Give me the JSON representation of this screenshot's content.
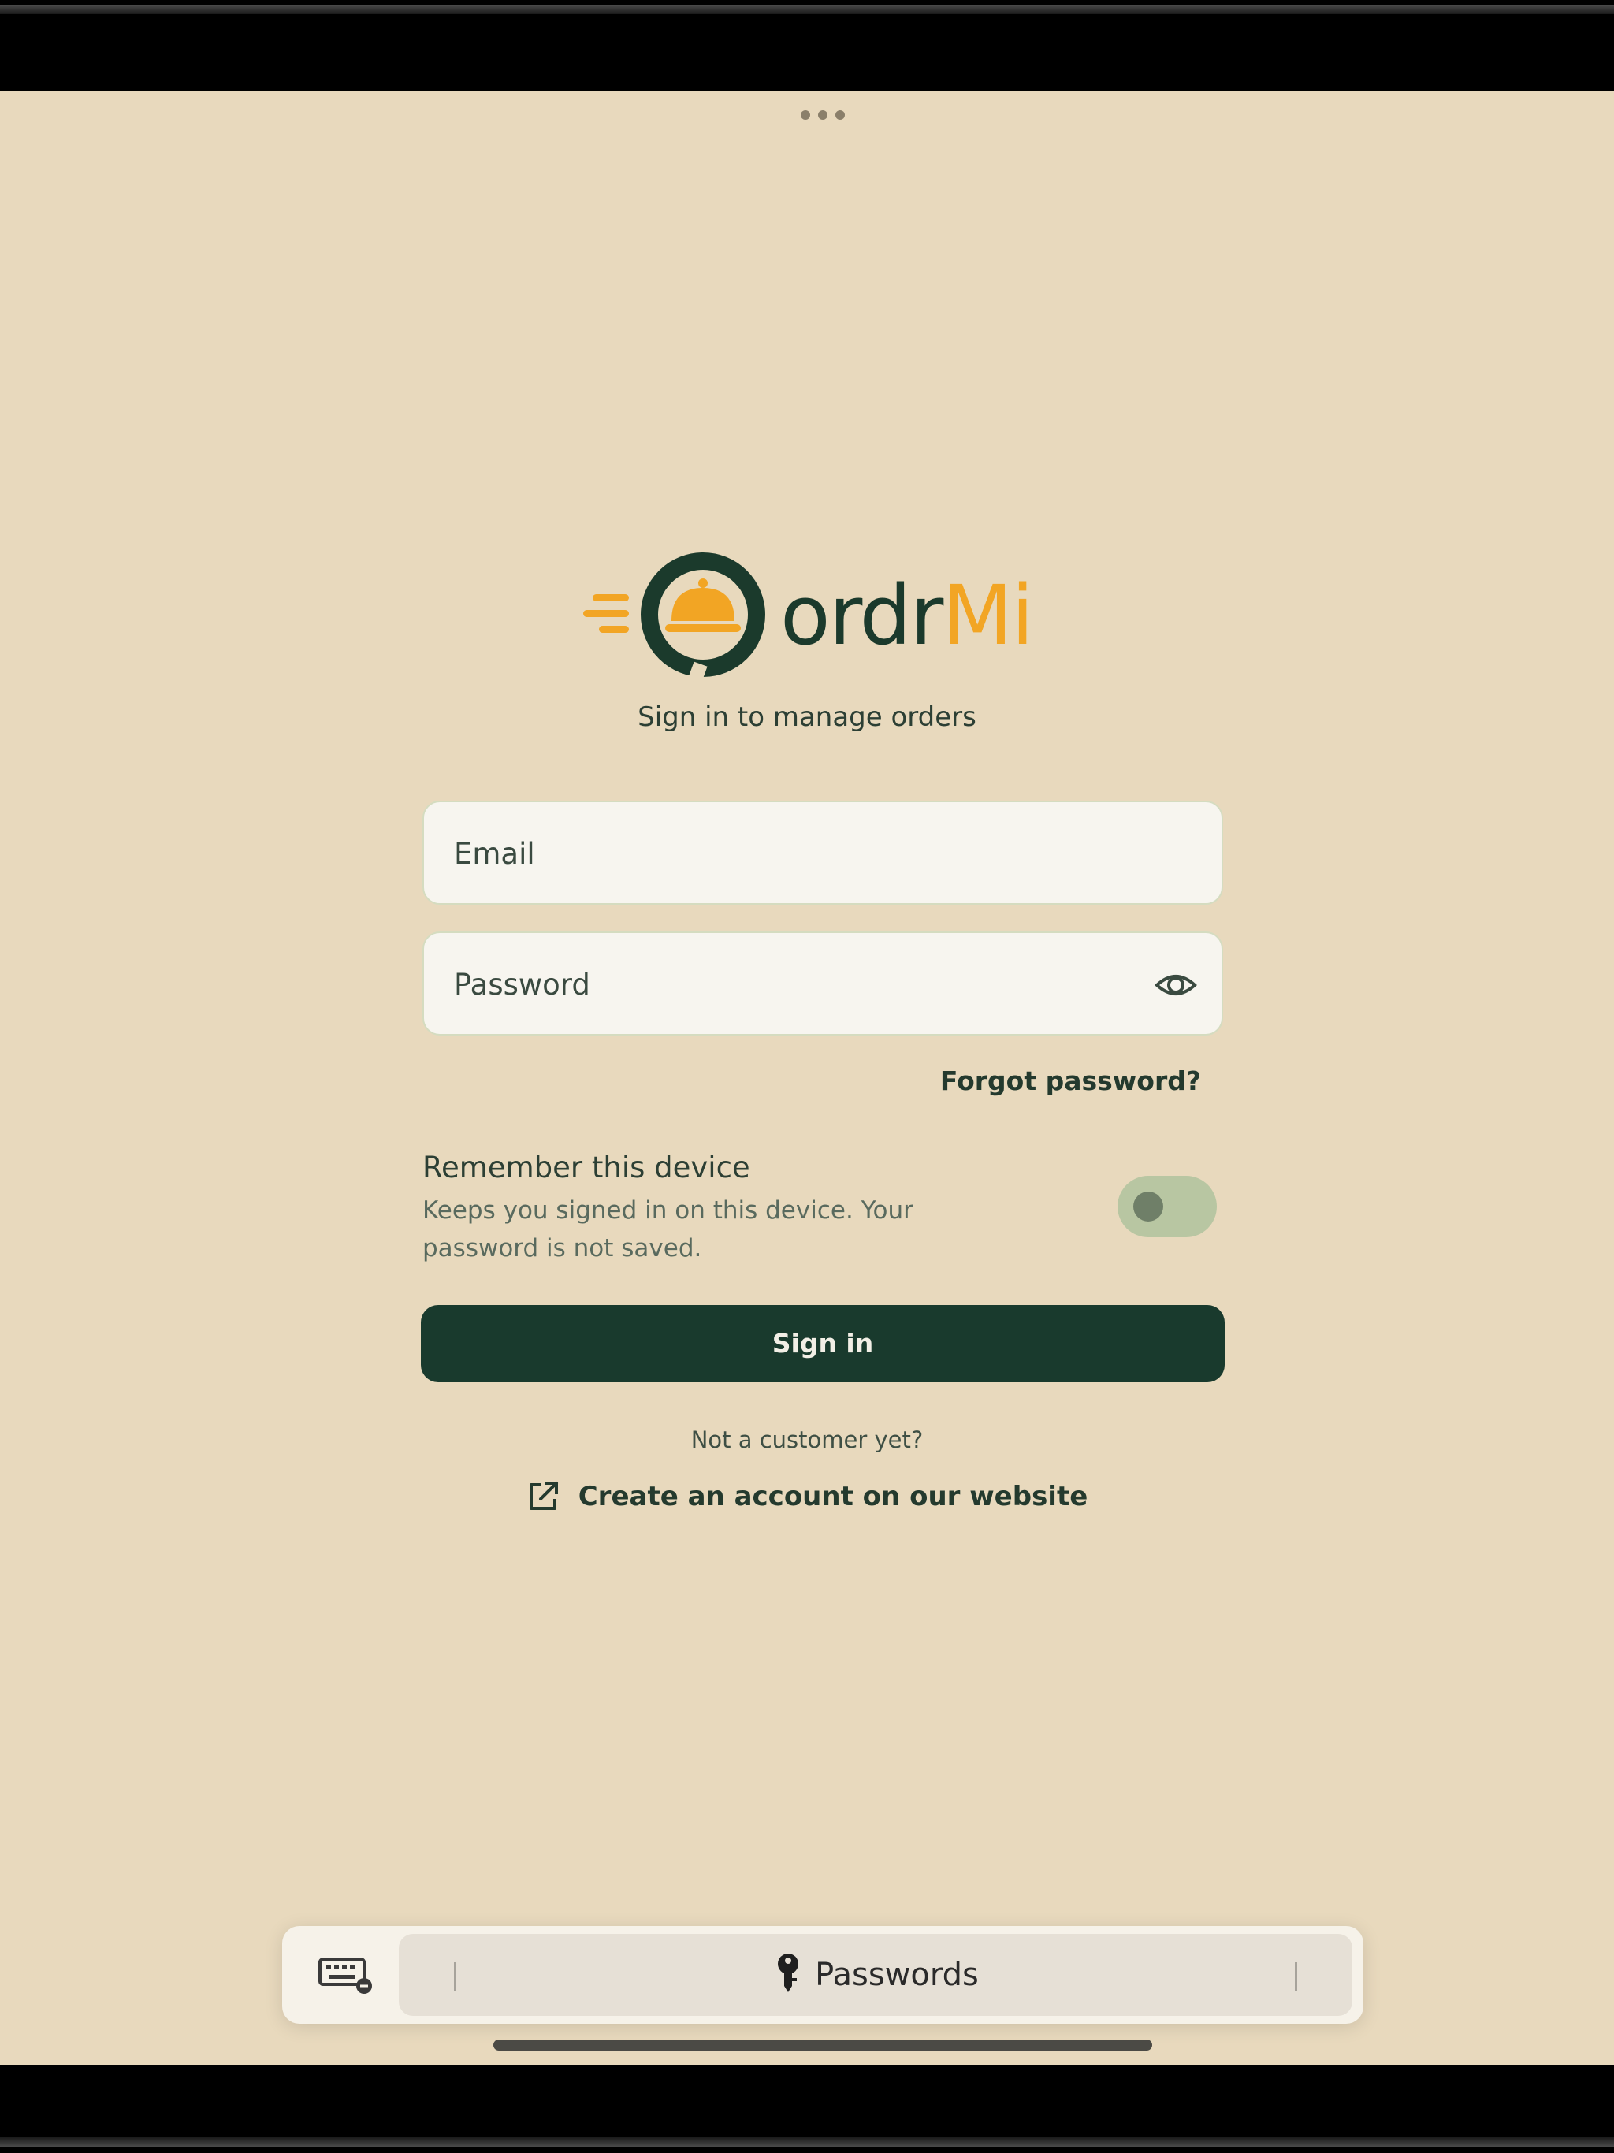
{
  "brand": {
    "name_part1": "ordr",
    "name_part2": "Mi",
    "primary_color": "#1b3a2c",
    "accent_color": "#f2a524"
  },
  "login": {
    "subtitle": "Sign in to manage orders",
    "email_placeholder": "Email",
    "password_placeholder": "Password",
    "forgot_password": "Forgot password?",
    "remember_title": "Remember this device",
    "remember_description": "Keeps you signed in on this device. Your password is not saved.",
    "remember_enabled": false,
    "sign_in_label": "Sign in",
    "not_customer": "Not a customer yet?",
    "create_account": "Create an account on our website"
  },
  "keyboard_bar": {
    "passwords_label": "Passwords"
  },
  "icons": {
    "password_visibility": "eye-icon",
    "create_account": "external-link-icon",
    "passwords": "key-icon",
    "keyboard": "keyboard-icon",
    "logo_mark": "service-bell-icon"
  }
}
